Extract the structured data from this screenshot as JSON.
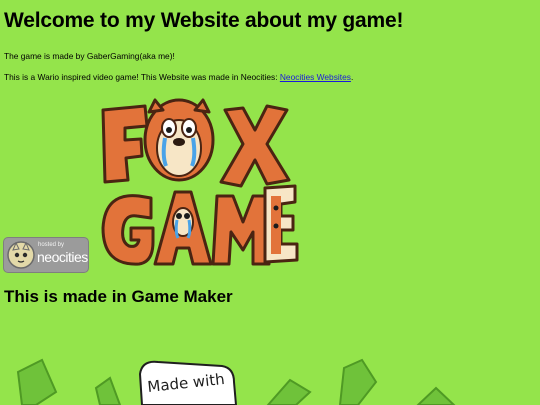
{
  "page": {
    "heading": "Welcome to my Website about my game!",
    "intro": "The game is made by GaberGaming(aka me)!",
    "description_prefix": "This is a Wario inspired video game! This Website was made in Neocities: ",
    "neocities_link": "Neocities Websites",
    "description_suffix": ".",
    "game_maker_heading": "This is made in Game Maker"
  },
  "logo": {
    "line1": "FOX",
    "line2": "GAME",
    "text_color": "#e2733a",
    "outline_color": "#4a2412"
  },
  "badge": {
    "small_text": "hosted by",
    "big_text": "neocities"
  },
  "artwork": {
    "scribble_text": "Made with"
  },
  "colors": {
    "background": "#94e44b",
    "link": "#1a1adc"
  }
}
